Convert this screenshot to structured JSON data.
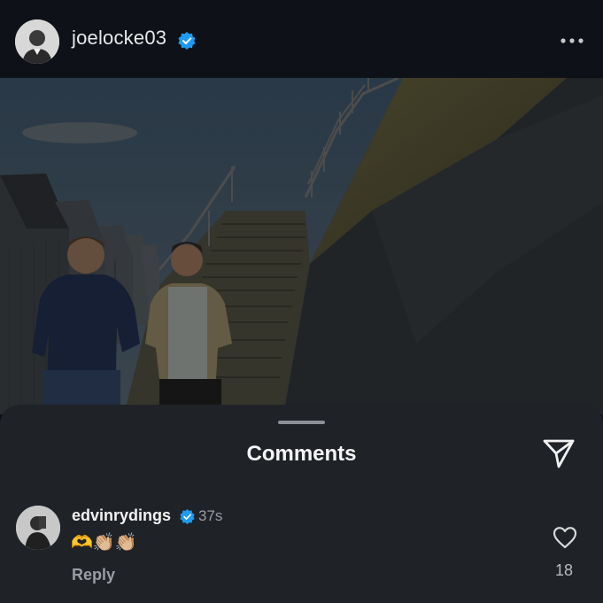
{
  "post": {
    "username": "joelocke03",
    "verified_icon": "verified-badge-icon",
    "more_icon": "more-options-icon"
  },
  "comments_sheet": {
    "title": "Comments",
    "share_icon": "send-icon"
  },
  "comments": [
    {
      "username": "edvinrydings",
      "time": "37s",
      "text": "🫶👏🏼👏🏼",
      "reply_label": "Reply",
      "likes": "18",
      "like_icon": "heart-outline-icon"
    }
  ],
  "colors": {
    "verified_blue": "#1d9bf0",
    "sheet_bg": "#1f2227"
  }
}
